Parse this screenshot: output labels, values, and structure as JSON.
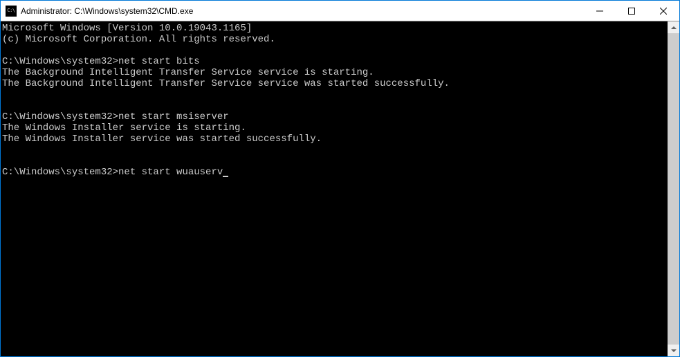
{
  "window": {
    "title": "Administrator: C:\\Windows\\system32\\CMD.exe"
  },
  "console": {
    "lines": [
      "Microsoft Windows [Version 10.0.19043.1165]",
      "(c) Microsoft Corporation. All rights reserved.",
      "",
      "C:\\Windows\\system32>net start bits",
      "The Background Intelligent Transfer Service service is starting.",
      "The Background Intelligent Transfer Service service was started successfully.",
      "",
      "",
      "C:\\Windows\\system32>net start msiserver",
      "The Windows Installer service is starting.",
      "The Windows Installer service was started successfully.",
      "",
      "",
      "C:\\Windows\\system32>net start wuauserv"
    ],
    "current_prompt": "C:\\Windows\\system32>",
    "current_command": "net start wuauserv"
  }
}
